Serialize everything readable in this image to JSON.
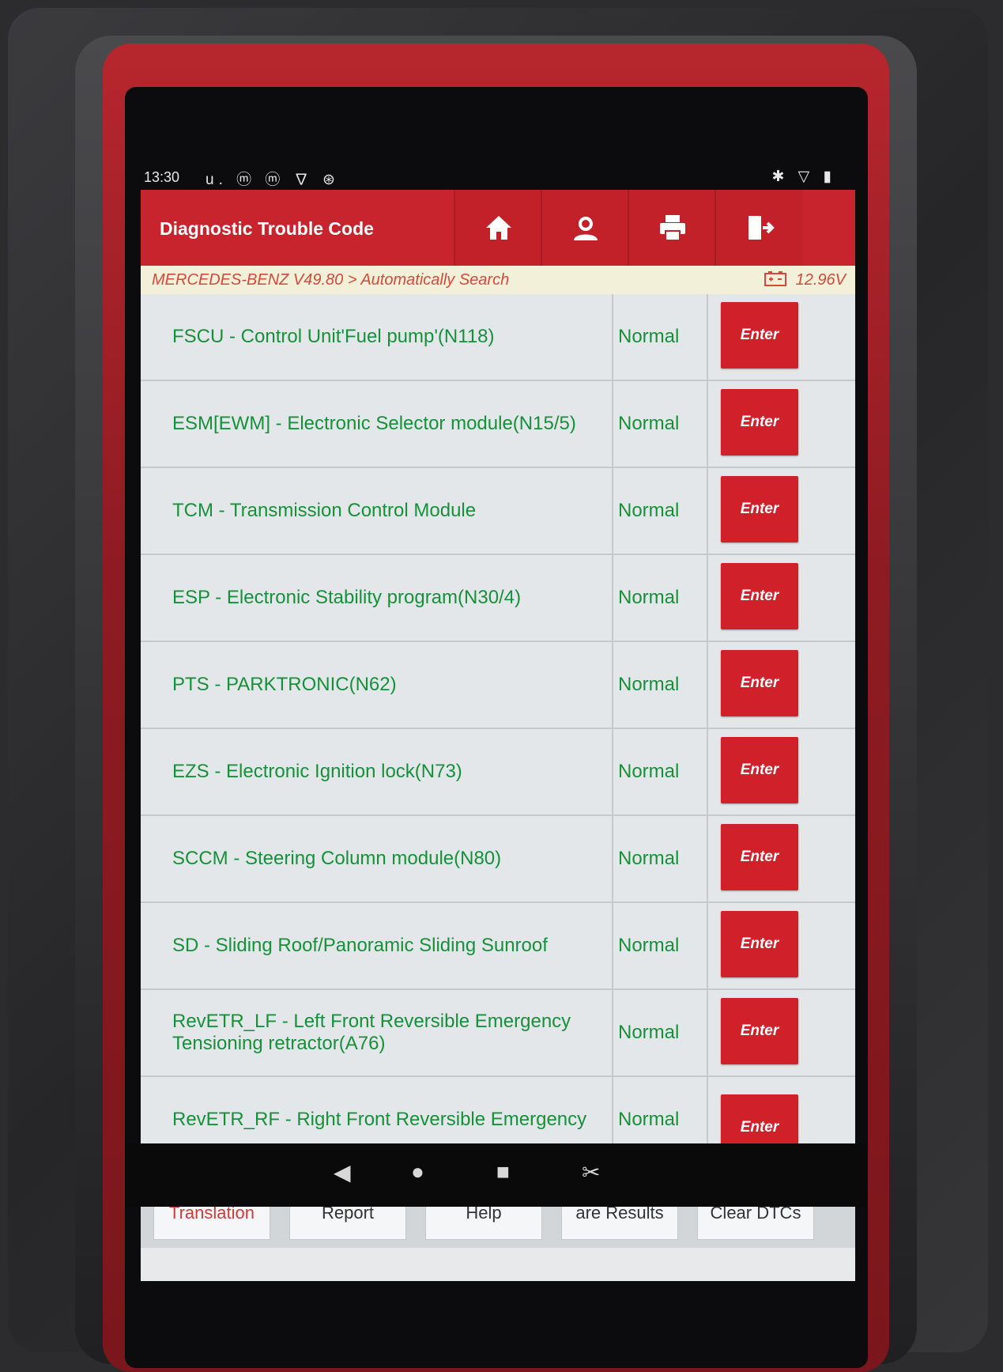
{
  "status_bar": {
    "time": "13:30",
    "left_icons": "u. ⓜ ⓜ ∇ ⊛",
    "right_icons": "✱ ▽ ▮"
  },
  "header": {
    "title": "Diagnostic Trouble Code",
    "buttons": [
      {
        "name": "home-icon"
      },
      {
        "name": "user-icon"
      },
      {
        "name": "printer-icon"
      },
      {
        "name": "exit-icon"
      }
    ]
  },
  "breadcrumb": {
    "path": "MERCEDES-BENZ V49.80 > Automatically Search",
    "voltage": "12.96V"
  },
  "table": {
    "rows": [
      {
        "name": "FSCU - Control Unit'Fuel pump'(N118)",
        "status": "Normal",
        "action": "Enter"
      },
      {
        "name": "ESM[EWM] - Electronic Selector module(N15/5)",
        "status": "Normal",
        "action": "Enter"
      },
      {
        "name": "TCM - Transmission Control Module",
        "status": "Normal",
        "action": "Enter"
      },
      {
        "name": "ESP - Electronic Stability program(N30/4)",
        "status": "Normal",
        "action": "Enter"
      },
      {
        "name": "PTS - PARKTRONIC(N62)",
        "status": "Normal",
        "action": "Enter"
      },
      {
        "name": "EZS - Electronic Ignition lock(N73)",
        "status": "Normal",
        "action": "Enter"
      },
      {
        "name": "SCCM - Steering Column module(N80)",
        "status": "Normal",
        "action": "Enter"
      },
      {
        "name": "SD - Sliding Roof/Panoramic Sliding Sunroof",
        "status": "Normal",
        "action": "Enter"
      },
      {
        "name": "RevETR_LF - Left Front Reversible Emergency Tensioning retractor(A76)",
        "status": "Normal",
        "action": "Enter"
      },
      {
        "name": "RevETR_RF - Right Front Reversible Emergency",
        "status": "Normal",
        "action": "Enter"
      }
    ]
  },
  "bottom_buttons": [
    {
      "label": "Translation"
    },
    {
      "label": "Report"
    },
    {
      "label": "Help"
    },
    {
      "label": "are Results"
    },
    {
      "label": "Clear DTCs"
    }
  ],
  "colors": {
    "header": "#c8242d",
    "row_text": "#15913a",
    "enter_button": "#d0202a",
    "breadcrumb_text": "#d34a3a"
  }
}
